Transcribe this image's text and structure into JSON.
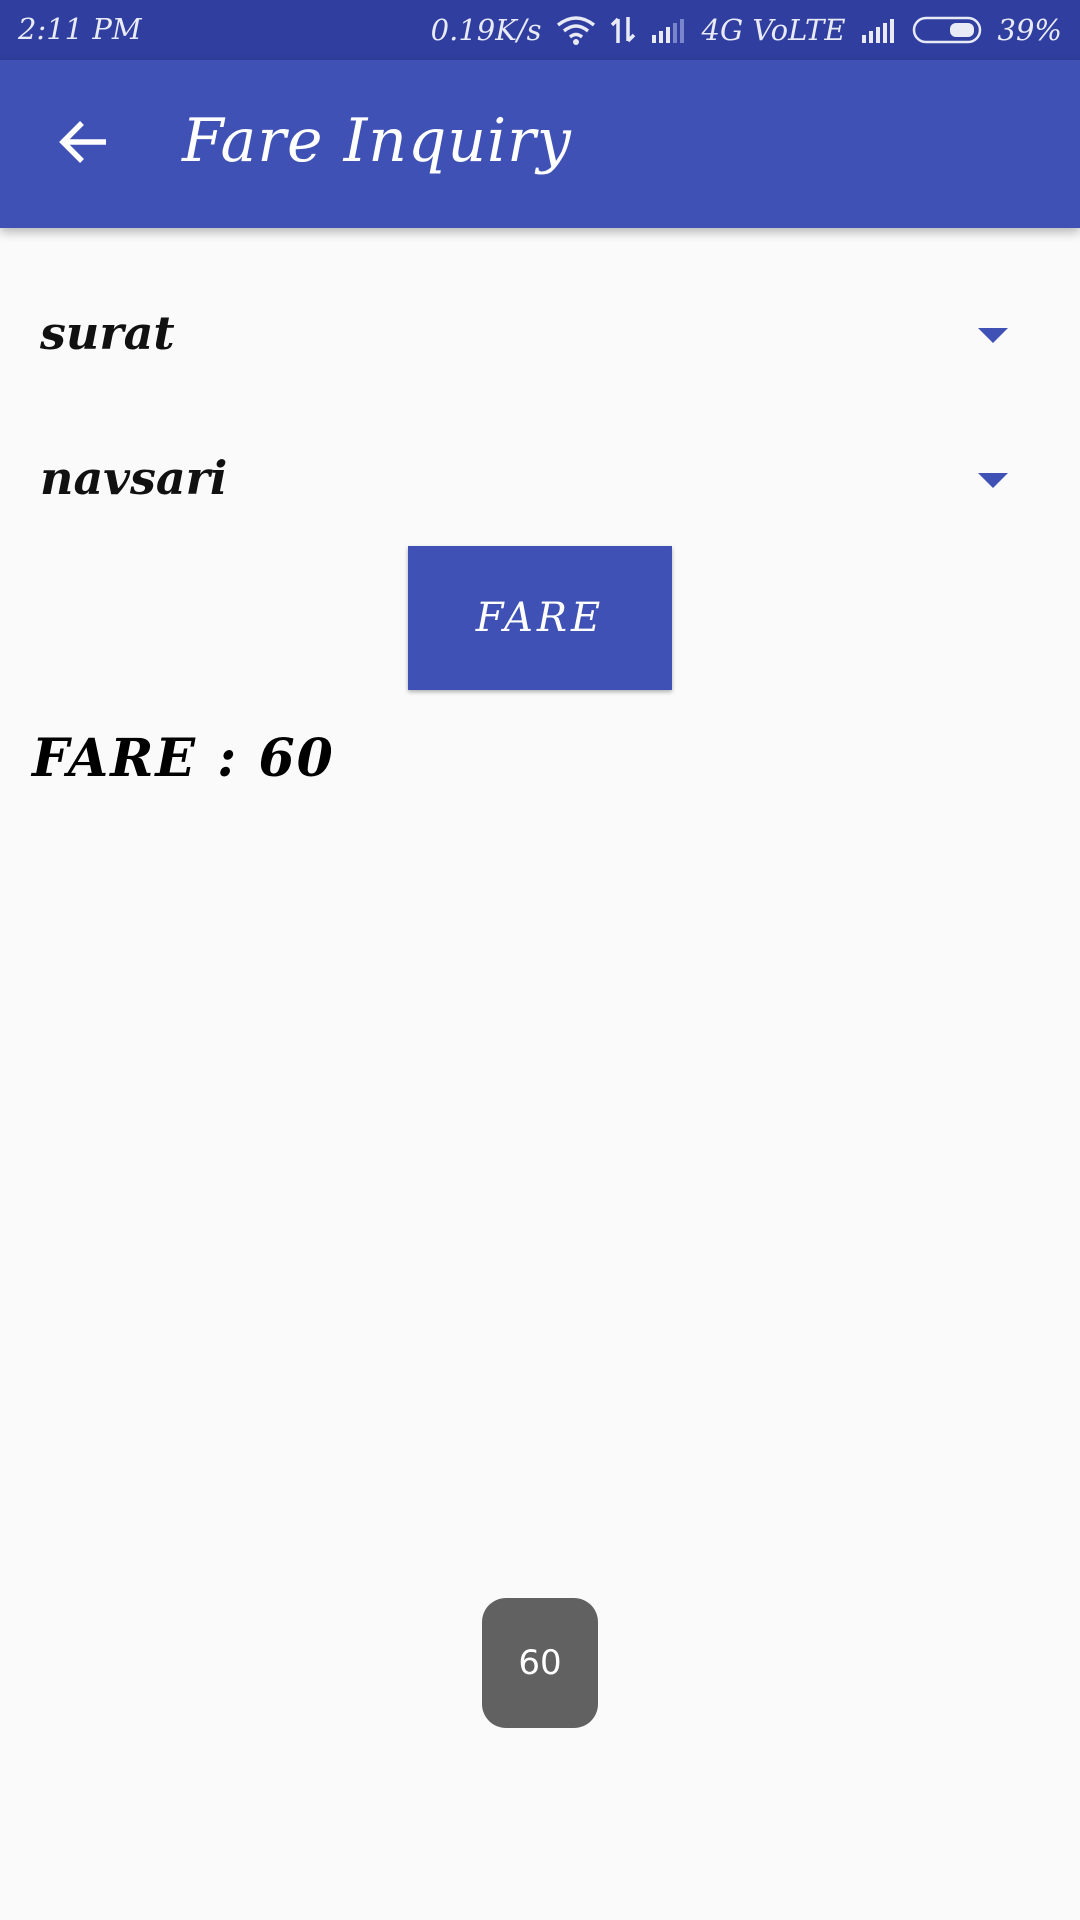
{
  "status_bar": {
    "time": "2:11 PM",
    "network_speed": "0.19K/s",
    "network_type": "4G VoLTE",
    "battery": "39%",
    "icons": [
      "wifi-icon",
      "data-transfer-icon",
      "signal-icon",
      "signal-icon",
      "battery-icon"
    ]
  },
  "app_bar": {
    "title": "Fare Inquiry",
    "back_icon": "arrow-back-icon"
  },
  "spinners": {
    "from": "surat",
    "to": "navsari"
  },
  "fare_button": {
    "label": "FARE"
  },
  "result": {
    "text": "FARE : 60"
  },
  "toast": {
    "text": "60"
  },
  "colors": {
    "primary": "#3f51b5",
    "primary_dark": "#303f9f",
    "background": "#fafafa",
    "toast": "#616161"
  }
}
